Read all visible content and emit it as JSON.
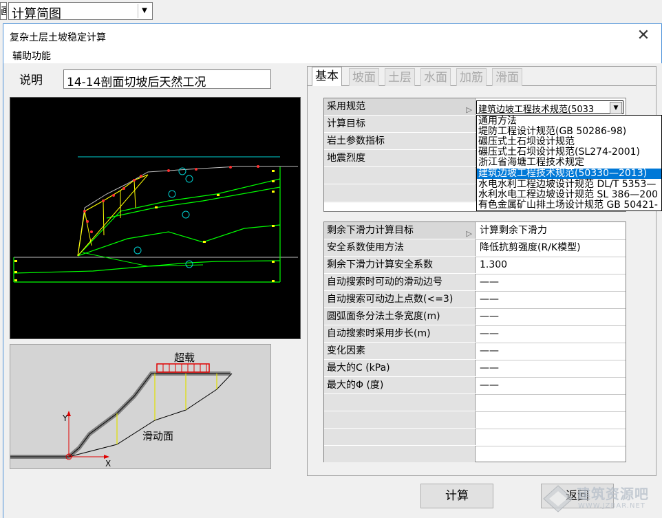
{
  "top_combo": {
    "value": "计算简图",
    "left_stub": "画"
  },
  "window": {
    "title": "复杂土层土坡稳定计算",
    "menu": "辅助功能"
  },
  "description": {
    "label": "说明",
    "value": "14-14剖面切坡后天然工况"
  },
  "sketch": {
    "surcharge_label": "超载",
    "slip_label": "滑动面",
    "x_axis": "X",
    "y_axis": "Y"
  },
  "tabs": [
    "基本",
    "坡面",
    "土层",
    "水面",
    "加筋",
    "滑面"
  ],
  "grid1": {
    "rows": [
      {
        "label": "采用规范",
        "value": "建筑边坡工程技术规范(5033"
      },
      {
        "label": "计算目标",
        "value": ""
      },
      {
        "label": "岩土参数指标",
        "value": ""
      },
      {
        "label": "地震烈度",
        "value": ""
      }
    ]
  },
  "dropdown_options": [
    "通用方法",
    "堤防工程设计规范(GB 50286-98)",
    "碾压式土石坝设计规范",
    "碾压式土石坝设计规范(SL274-2001)",
    "浙江省海塘工程技术规定",
    "建筑边坡工程技术规范(50330—2013)",
    "水电水利工程边坡设计规范 DL/T 5353—",
    "水利水电工程边坡设计规范 SL 386—200",
    "有色金属矿山排土场设计规范 GB 50421-"
  ],
  "grid2": {
    "rows": [
      {
        "label": "剩余下滑力计算目标",
        "value": "计算剩余下滑力"
      },
      {
        "label": "安全系数使用方法",
        "value": "降低抗剪强度(R/K模型)"
      },
      {
        "label": "剩余下滑力计算安全系数",
        "value": "1.300"
      },
      {
        "label": "自动搜索时可动的滑动边号",
        "value": "——"
      },
      {
        "label": "自动搜索可动边上点数(<=3)",
        "value": "——"
      },
      {
        "label": "圆弧面条分法土条宽度(m)",
        "value": "——"
      },
      {
        "label": "自动搜索时采用步长(m)",
        "value": "——"
      },
      {
        "label": "变化因素",
        "value": "——"
      },
      {
        "label": "最大的C (kPa)",
        "value": "——"
      },
      {
        "label": "最大的Φ (度)",
        "value": "——"
      }
    ]
  },
  "buttons": {
    "calc": "计算",
    "back": "返回"
  },
  "watermark": {
    "big": "建筑资源吧",
    "small": "WWW.JZBAR.NET"
  },
  "colors": {
    "selection": "#0078d7",
    "canvas": "#000000",
    "profile_line": "#00ff00",
    "slope_line": "#ffff00"
  }
}
